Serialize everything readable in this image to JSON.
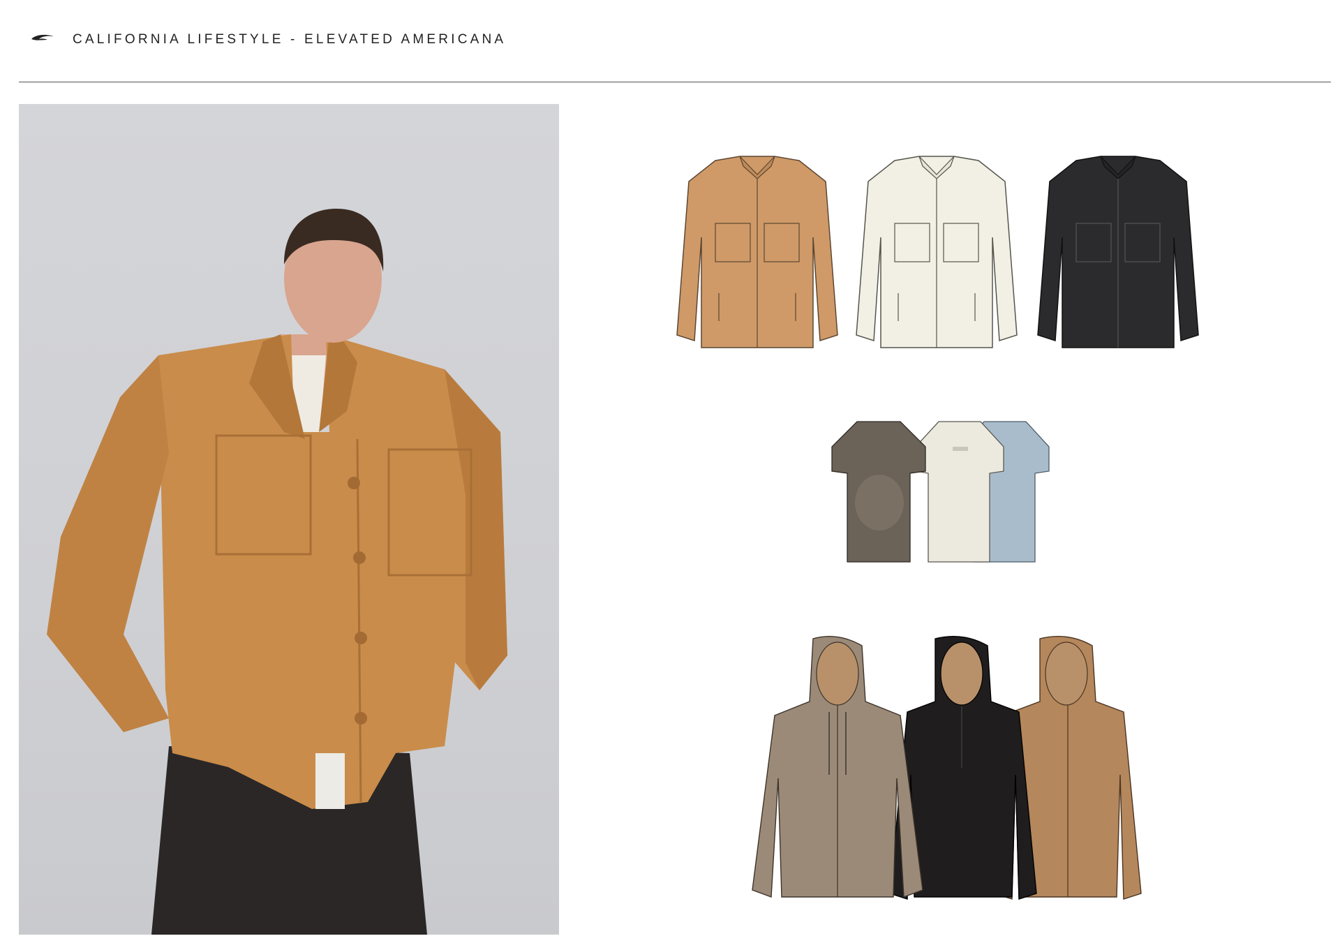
{
  "header": {
    "logo_icon": "oneill-wave-logo",
    "title": "CALIFORNIA LIFESTYLE - ELEVATED AMERICANA"
  },
  "colors": {
    "rule": "#555555",
    "photo_background": "#d0d1d5",
    "shirt_tan": "#cf9a68",
    "shirt_cream": "#f2f0e4",
    "shirt_black": "#2b2b2d",
    "tee_brown": "#6b6258",
    "tee_cream": "#ece9df",
    "tee_blue": "#a9bccb",
    "hoodie_taupe": "#9c8a78",
    "hoodie_black": "#1f1d1e",
    "hoodie_tan": "#b5875c"
  },
  "lookbook": {
    "model_photo": "model-wearing-tan-corduroy-overshirt",
    "overshirts": [
      "tan",
      "cream",
      "black"
    ],
    "tees": [
      "brown-tie-dye",
      "cream",
      "light-blue"
    ],
    "hoodies": [
      "taupe",
      "black",
      "tan"
    ]
  }
}
